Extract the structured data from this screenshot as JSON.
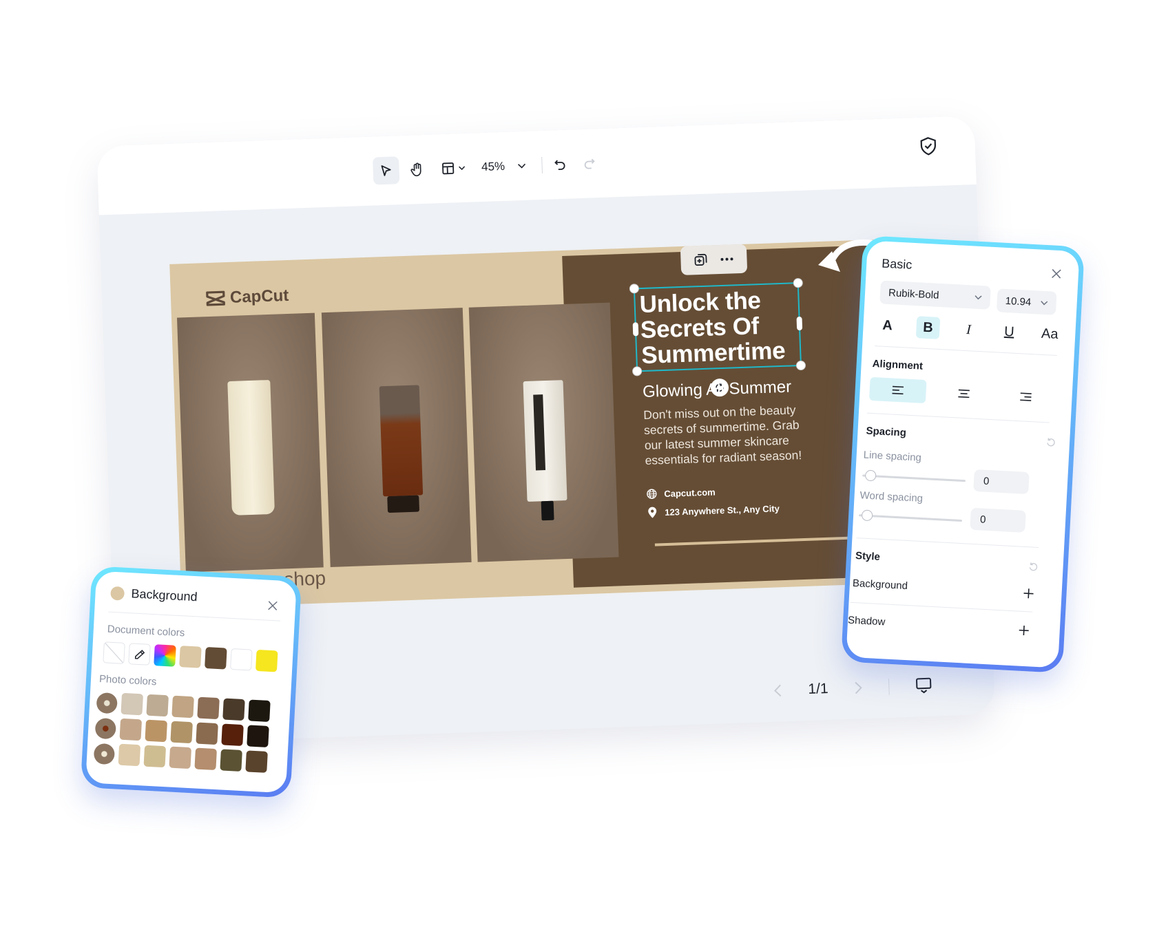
{
  "toolbar": {
    "zoom": "45%",
    "tools": [
      "select-icon",
      "hand-icon",
      "layout-icon",
      "undo-icon",
      "redo-icon",
      "shield-icon"
    ]
  },
  "canvas": {
    "logo": "CapCut",
    "shop_text": "shop",
    "headline": [
      "Unlock the",
      "Secrets Of",
      "Summertime"
    ],
    "subtitle": "Glowing All Summer",
    "body": "Don't miss out on the beauty secrets of summertime. Grab our latest summer skincare essentials for radiant season!",
    "website": "Capcut.com",
    "address": "123 Anywhere St., Any City",
    "colors": {
      "background": "#dbc7a3",
      "panel": "#654d35",
      "selection": "#1fb8c9"
    }
  },
  "pager": {
    "page": "1/1"
  },
  "basic_panel": {
    "title": "Basic",
    "font": "Rubik-Bold",
    "size": "10.94",
    "styles": [
      "A",
      "B",
      "I",
      "U",
      "Aa"
    ],
    "alignment_label": "Alignment",
    "spacing_label": "Spacing",
    "line_spacing_label": "Line spacing",
    "line_spacing": "0",
    "word_spacing_label": "Word spacing",
    "word_spacing": "0",
    "style_label": "Style",
    "background_label": "Background",
    "shadow_label": "Shadow"
  },
  "bg_panel": {
    "title": "Background",
    "current_color": "#dbc7a3",
    "document_label": "Document colors",
    "document_colors": [
      "none",
      "eyedropper",
      "rainbow",
      "#dbc7a3",
      "#634c35",
      "#ffffff",
      "#f5e61f"
    ],
    "photo_label": "Photo colors",
    "photo_colors": [
      [
        "#d3c7b6",
        "#bdab93",
        "#c0a483",
        "#8b6c55",
        "#4a3a2a",
        "#1c1810"
      ],
      [
        "#c4a78b",
        "#bb9466",
        "#b09468",
        "#8b6b4f",
        "#56200b",
        "#1e160e"
      ],
      [
        "#ddc9a8",
        "#cfbd92",
        "#c7a98d",
        "#b48e6e",
        "#5a5233",
        "#5a432c"
      ]
    ]
  }
}
